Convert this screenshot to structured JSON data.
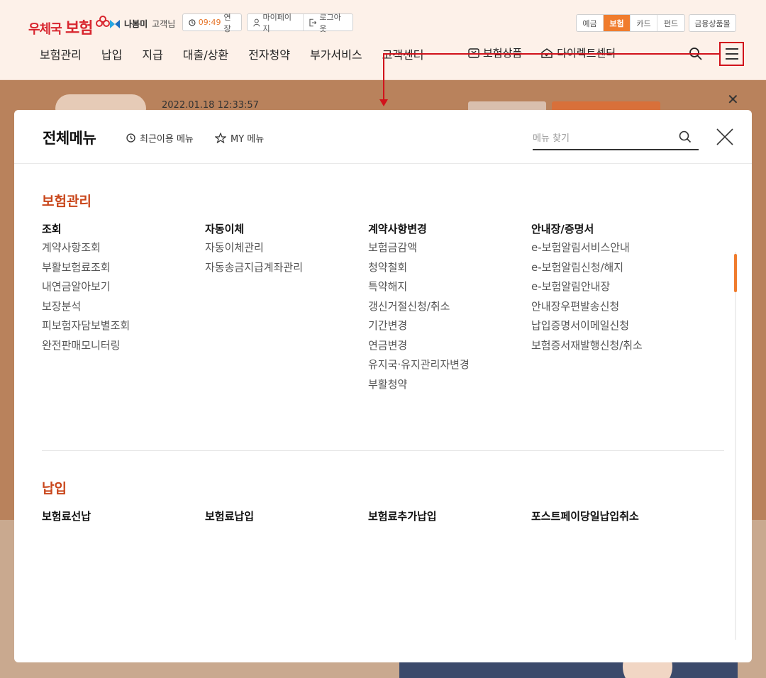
{
  "header": {
    "logo_prefix": "우체국",
    "logo_main": "보험",
    "user_name": "나봄미",
    "user_suffix": "고객님",
    "session_time": "09:49",
    "extend_label": "연장",
    "mypage_label": "마이페이지",
    "logout_label": "로그아웃",
    "service_tabs": [
      "예금",
      "보험",
      "카드",
      "펀드"
    ],
    "active_service": "보험",
    "fin_products_label": "금융상품몰",
    "gnb": [
      "보험관리",
      "납입",
      "지급",
      "대출/상환",
      "전자청약",
      "부가서비스",
      "고객센터"
    ],
    "gnb_extra": [
      "보험상품",
      "다이렉트센터"
    ]
  },
  "background": {
    "datetime": "2022.01.18 12:33:57"
  },
  "modal": {
    "title": "전체메뉴",
    "recent_label": "최근이용 메뉴",
    "my_label": "MY 메뉴",
    "search_placeholder": "메뉴 찾기",
    "sections": [
      {
        "title": "보험관리",
        "columns": [
          {
            "title": "조회",
            "items": [
              "계약사항조회",
              "부활보험료조회",
              "내연금알아보기",
              "보장분석",
              "피보험자담보별조회",
              "완전판매모니터링"
            ]
          },
          {
            "title": "자동이체",
            "items": [
              "자동이체관리",
              "자동송금지급계좌관리"
            ]
          },
          {
            "title": "계약사항변경",
            "items": [
              "보험금감액",
              "청약철회",
              "특약해지",
              "갱신거절신청/취소",
              "기간변경",
              "연금변경",
              "유지국·유지관리자변경",
              "부활청약"
            ]
          },
          {
            "title": "안내장/증명서",
            "items": [
              "e-보험알림서비스안내",
              "e-보험알림신청/해지",
              "e-보험알림안내장",
              "안내장우편발송신청",
              "납입증명서이메일신청",
              "보험증서재발행신청/취소"
            ]
          }
        ]
      },
      {
        "title": "납입",
        "columns": [
          {
            "title": "보험료선납",
            "items": []
          },
          {
            "title": "보험료납입",
            "items": []
          },
          {
            "title": "보험료추가납입",
            "items": []
          },
          {
            "title": "포스트페이당일납입취소",
            "items": []
          }
        ]
      }
    ]
  },
  "colors": {
    "accent": "#f07c2d",
    "section_title": "#c9461b",
    "brand_red": "#d8262f",
    "annotation_red": "#d1121b"
  }
}
